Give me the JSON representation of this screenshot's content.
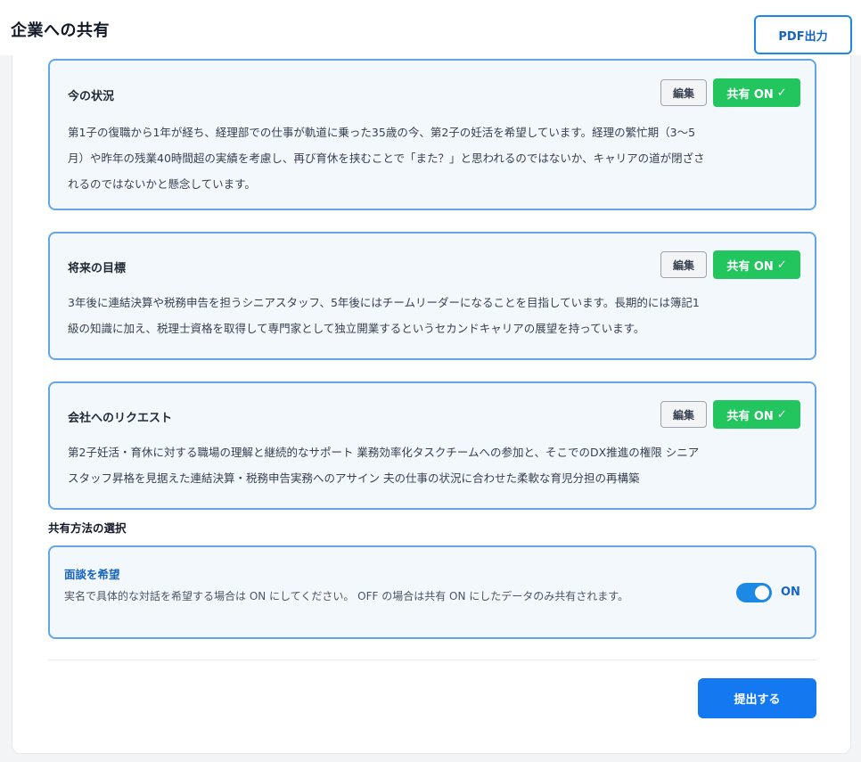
{
  "header": {
    "title": "企業への共有",
    "pdf_button": "PDF出力"
  },
  "cards": [
    {
      "title": "今の状況",
      "edit": "編集",
      "share": "共有 ON",
      "share_icon": "✓",
      "lines": [
        "第1子の復職から1年が経ち、経理部での仕事が軌道に乗った35歳の今、第2子の妊活を希望しています。経理の繁忙期（3〜5",
        "月）や昨年の残業40時間超の実績を考慮し、再び育休を挟むことで「また？」と思われるのではないか、キャリアの道が閉ざさ",
        "れるのではないかと懸念しています。"
      ]
    },
    {
      "title": "将来の目標",
      "edit": "編集",
      "share": "共有 ON",
      "share_icon": "✓",
      "lines": [
        "3年後に連結決算や税務申告を担うシニアスタッフ、5年後にはチームリーダーになることを目指しています。長期的には簿記1",
        "級の知識に加え、税理士資格を取得して専門家として独立開業するというセカンドキャリアの展望を持っています。"
      ]
    },
    {
      "title": "会社へのリクエスト",
      "edit": "編集",
      "share": "共有 ON",
      "share_icon": "✓",
      "lines": [
        "第2子妊活・育休に対する職場の理解と継続的なサポート 業務効率化タスクチームへの参加と、そこでのDX推進の権限 シニア",
        "スタッフ昇格を見据えた連結決算・税務申告実務へのアサイン 夫の仕事の状況に合わせた柔軟な育児分担の再構築"
      ]
    }
  ],
  "share_method": {
    "label": "共有方法の選択",
    "interview_title": "面談を希望",
    "interview_desc": "実名で具体的な対話を希望する場合は ON にしてください。 OFF の場合は共有 ON にしたデータのみ共有されます。",
    "toggle_state": "ON"
  },
  "footer": {
    "submit": "提出する"
  },
  "colors": {
    "accent": "#1479f0",
    "share_green": "#22c55e",
    "card_border": "#62a6e6"
  }
}
